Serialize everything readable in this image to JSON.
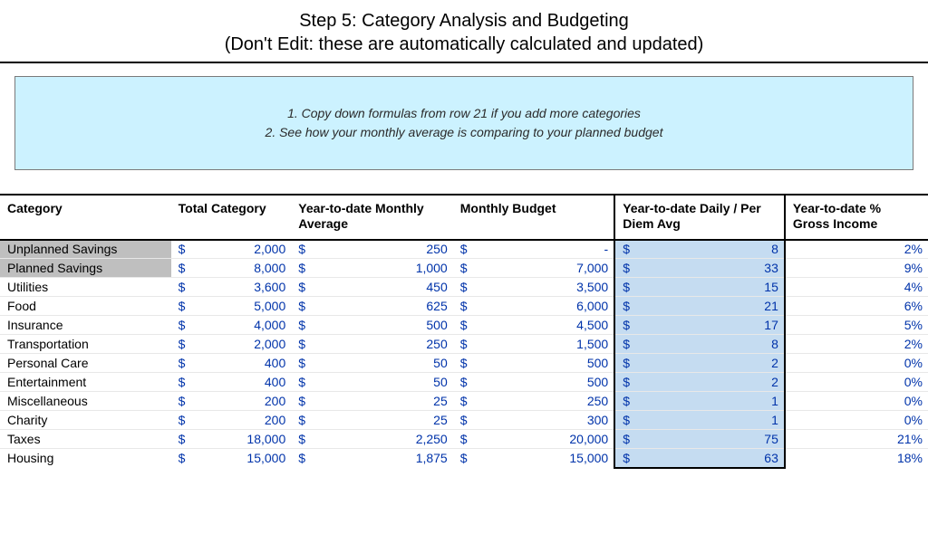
{
  "header": {
    "title": "Step 5: Category Analysis and Budgeting",
    "subtitle": "(Don't Edit: these are automatically calculated and updated)"
  },
  "info": {
    "line1": "1. Copy down formulas from row 21 if you add more categories",
    "line2": "2. See how your monthly average is comparing to your planned budget"
  },
  "columns": {
    "category": "Category",
    "total": "Total Category",
    "avg": "Year-to-date Monthly Average",
    "budget": "Monthly Budget",
    "perdiem": "Year-to-date Daily / Per Diem Avg",
    "pct": "Year-to-date % Gross Income"
  },
  "currency_symbol": "$",
  "chart_data": {
    "type": "table",
    "columns": [
      "Category",
      "Total Category",
      "Year-to-date Monthly Average",
      "Monthly Budget",
      "Year-to-date Daily / Per Diem Avg",
      "Year-to-date % Gross Income"
    ],
    "rows": [
      {
        "category": "Unplanned Savings",
        "total": "2,000",
        "avg": "250",
        "budget": "-",
        "perdiem": "8",
        "pct": "2%",
        "highlight": true
      },
      {
        "category": "Planned Savings",
        "total": "8,000",
        "avg": "1,000",
        "budget": "7,000",
        "perdiem": "33",
        "pct": "9%",
        "highlight": true
      },
      {
        "category": "Utilities",
        "total": "3,600",
        "avg": "450",
        "budget": "3,500",
        "perdiem": "15",
        "pct": "4%"
      },
      {
        "category": "Food",
        "total": "5,000",
        "avg": "625",
        "budget": "6,000",
        "perdiem": "21",
        "pct": "6%"
      },
      {
        "category": "Insurance",
        "total": "4,000",
        "avg": "500",
        "budget": "4,500",
        "perdiem": "17",
        "pct": "5%"
      },
      {
        "category": "Transportation",
        "total": "2,000",
        "avg": "250",
        "budget": "1,500",
        "perdiem": "8",
        "pct": "2%"
      },
      {
        "category": "Personal Care",
        "total": "400",
        "avg": "50",
        "budget": "500",
        "perdiem": "2",
        "pct": "0%"
      },
      {
        "category": "Entertainment",
        "total": "400",
        "avg": "50",
        "budget": "500",
        "perdiem": "2",
        "pct": "0%"
      },
      {
        "category": "Miscellaneous",
        "total": "200",
        "avg": "25",
        "budget": "250",
        "perdiem": "1",
        "pct": "0%"
      },
      {
        "category": "Charity",
        "total": "200",
        "avg": "25",
        "budget": "300",
        "perdiem": "1",
        "pct": "0%"
      },
      {
        "category": "Taxes",
        "total": "18,000",
        "avg": "2,250",
        "budget": "20,000",
        "perdiem": "75",
        "pct": "21%"
      },
      {
        "category": "Housing",
        "total": "15,000",
        "avg": "1,875",
        "budget": "15,000",
        "perdiem": "63",
        "pct": "18%"
      }
    ]
  }
}
